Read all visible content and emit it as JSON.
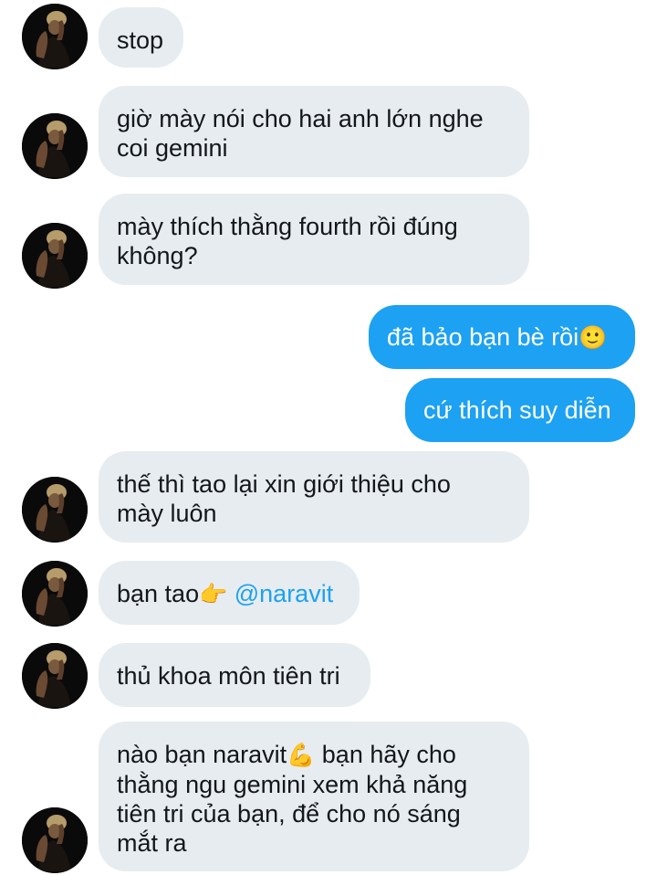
{
  "conversation": {
    "messages": [
      {
        "side": "in",
        "lines": [
          "stop"
        ]
      },
      {
        "side": "in",
        "lines": [
          "giờ mày nói cho hai anh lớn nghe",
          "coi gemini"
        ]
      },
      {
        "side": "in",
        "lines": [
          "mày thích thằng fourth rồi đúng",
          "không?"
        ]
      },
      {
        "side": "out",
        "text": "đã bảo bạn bè rồi",
        "emoji": "🙂"
      },
      {
        "side": "out",
        "text": "cứ thích suy diễn"
      },
      {
        "side": "in",
        "lines": [
          "thế thì tao lại xin giới thiệu cho",
          "mày luôn"
        ]
      },
      {
        "side": "in",
        "text_before": "bạn tao",
        "emoji": "👉",
        "mention": "@naravit"
      },
      {
        "side": "in",
        "lines": [
          "thủ khoa môn tiên tri"
        ]
      },
      {
        "side": "in",
        "first_line_before": "nào bạn naravit",
        "emoji": "💪",
        "first_line_after": " bạn hãy cho",
        "lines": [
          "thằng ngu gemini xem khả năng",
          "tiên tri của bạn, để cho nó sáng",
          "mắt ra"
        ]
      }
    ]
  },
  "colors": {
    "incoming_bubble": "#e6ecf0",
    "outgoing_bubble": "#1da1f2",
    "mention": "#1da1f2",
    "text": "#14171a"
  }
}
